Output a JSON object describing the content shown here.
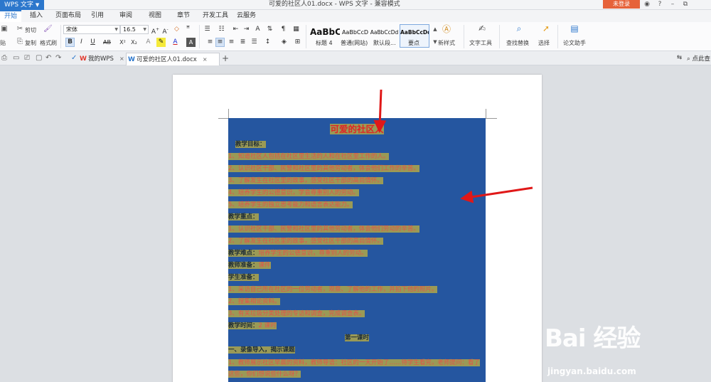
{
  "titlebar": {
    "app_menu": "WPS 文字",
    "doc_title": "可爱的社区人01.docx - WPS 文字 - 兼容模式",
    "login": "未登录",
    "controls": [
      "◉",
      "?",
      "–",
      "⧉"
    ]
  },
  "menu": {
    "tabs": [
      "开始",
      "插入",
      "页面布局",
      "引用",
      "审阅",
      "视图",
      "章节",
      "开发工具",
      "云服务"
    ],
    "active": "开始"
  },
  "ribbon": {
    "clipboard": {
      "cut": "剪切",
      "copy": "复制",
      "format_painter": "格式刷",
      "paste_partial": "贴"
    },
    "font": {
      "name": "宋体",
      "size": "16.5"
    },
    "format_buttons": [
      "B",
      "I",
      "U",
      "AB",
      "X²",
      "X₂",
      "A",
      "A"
    ],
    "styles": [
      {
        "preview": "AaBbC",
        "label": "标题 4"
      },
      {
        "preview": "AaBbCcD",
        "label": "普通(网站)"
      },
      {
        "preview": "AaBbCcDd",
        "label": "默认段..."
      },
      {
        "preview": "AaBbCcDd",
        "label": "要点"
      }
    ],
    "new_style": "新样式",
    "text_tools": "文字工具",
    "find_replace": "查找替换",
    "select": "选择",
    "essay_assistant": "论文助手"
  },
  "tabstrip": {
    "tabs": [
      {
        "label": "我的WPS",
        "icon": "W"
      },
      {
        "label": "可爱的社区人01.docx",
        "icon": "W"
      }
    ],
    "right_label": "点此查"
  },
  "document": {
    "title": "可爱的社区人",
    "lines": [
      {
        "text": "教学目标：",
        "style": "bold-indent"
      },
      {
        "text": "1、知道社区人包括在社区里生活的人和在社区里工作的人。",
        "style": "plain"
      },
      {
        "text": "2、认识社区干部、民警和社区里的其他劳动者，体会他们工作的辛苦。",
        "style": "plain"
      },
      {
        "text": "3、了解发生在社区里的故事，感受社区干部的高尚情怀。",
        "style": "plain"
      },
      {
        "text": "4、培养学生的公德意识，学会尊重别人的劳动。",
        "style": "plain"
      },
      {
        "text": "5、培养学生的独立思考能力和语言表达能力。",
        "style": "plain"
      },
      {
        "text": "教学重点：",
        "style": "bold"
      },
      {
        "text": "1、认识社区干部、民警和社区里的其他劳动者，体会他们劳动的辛苦。",
        "style": "plain"
      },
      {
        "text": "2、了解发生在社区里的故事，感受社区干部的高尚情怀。",
        "style": "plain"
      },
      {
        "label": "教学难点：",
        "text": "培养学生的公德意识，尊重别人的劳动。",
        "style": "mixed"
      },
      {
        "label": "教师准备：",
        "text": "课件",
        "style": "mixed"
      },
      {
        "text": "学生准备：",
        "style": "bold"
      },
      {
        "text": "1、采访自己所在社区的一位劳动者，观察、了解他的工作，并拍下他的照片。",
        "style": "plain"
      },
      {
        "text": "2、搜集相论资料。",
        "style": "plain"
      },
      {
        "text": "3、有关垃圾分类处理的专访和调查，完成调查表。",
        "style": "plain"
      },
      {
        "label": "教学时间：",
        "text": "2 课时",
        "style": "mixed"
      },
      {
        "text": "第一课时",
        "style": "center-bold"
      },
      {
        "text": "一、录像导入，揭示课题",
        "style": "bold"
      },
      {
        "text": "1、教师展示社区早晨的资料，教师导语：社区的一天开始了……待学生看完，老师提问：看了这些，你们想说些什么呀？",
        "style": "wrap"
      }
    ]
  },
  "watermark": {
    "brand": "Bai 经验",
    "url": "jingyan.baidu.com"
  }
}
